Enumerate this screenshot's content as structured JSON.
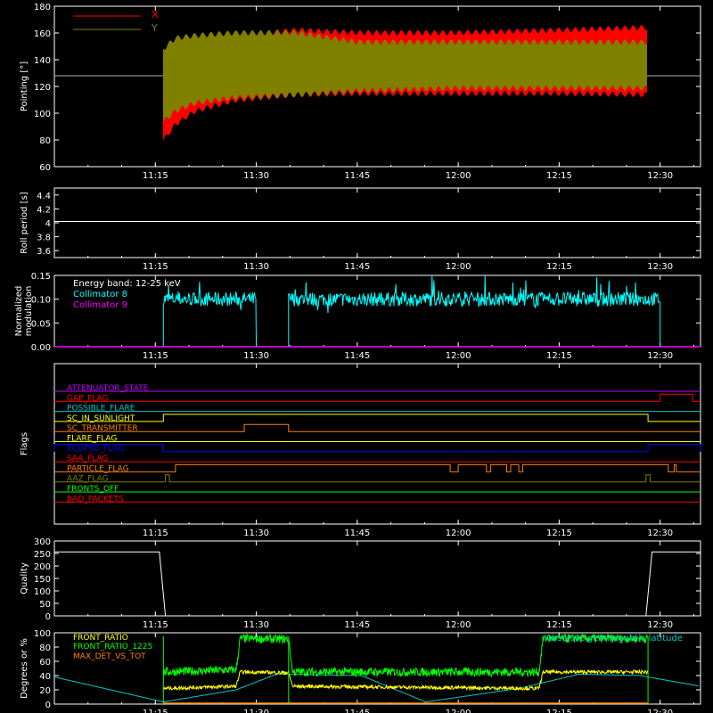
{
  "chart_data": [
    {
      "type": "area",
      "ylabel": "Pointing [°]",
      "ylim": [
        60,
        180
      ],
      "yticks": [
        60,
        80,
        100,
        120,
        140,
        160,
        180
      ],
      "xticks": [
        "11:15",
        "11:30",
        "11:45",
        "12:00",
        "12:15",
        "12:30"
      ],
      "legend": "top-left",
      "series": [
        {
          "name": "X",
          "color": "#ff0000",
          "x": [
            11.27,
            11.3,
            11.35,
            11.45,
            11.6,
            11.75,
            12.0,
            12.25,
            12.47
          ],
          "upper": [
            150,
            148,
            152,
            160,
            164,
            162,
            162,
            164,
            166
          ],
          "lower": [
            78,
            90,
            100,
            108,
            112,
            113,
            113,
            113,
            112
          ]
        },
        {
          "name": "Y",
          "color": "#808000",
          "x": [
            11.27,
            11.3,
            11.35,
            11.45,
            11.6,
            11.75,
            12.0,
            12.25,
            12.47
          ],
          "upper": [
            150,
            158,
            160,
            162,
            162,
            155,
            155,
            155,
            155
          ],
          "lower": [
            92,
            100,
            106,
            110,
            112,
            115,
            117,
            117,
            117
          ]
        }
      ],
      "reference_line": {
        "value": 128,
        "color": "#b0b0b0"
      }
    },
    {
      "type": "line",
      "ylabel": "Roll period [s]",
      "ylim": [
        3.5,
        4.5
      ],
      "yticks": [
        3.6,
        3.8,
        4.0,
        4.2,
        4.4
      ],
      "xticks": [
        "11:15",
        "11:30",
        "11:45",
        "12:00",
        "12:15",
        "12:30"
      ],
      "series": [
        {
          "name": "",
          "color": "#ffffff",
          "value": 4.02
        }
      ]
    },
    {
      "type": "line",
      "ylabel": "Normalized modulation",
      "ylim": [
        0,
        0.15
      ],
      "yticks": [
        "0.00",
        "0.05",
        "0.10",
        "0.15"
      ],
      "xticks": [
        "11:15",
        "11:30",
        "11:45",
        "12:00",
        "12:15",
        "12:30"
      ],
      "legend_title": "Energy band: 12-25 keV",
      "series": [
        {
          "name": "Collimator 8",
          "color": "#00ffff",
          "mean": 0.1,
          "segments": [
            [
              11.27,
              11.5
            ],
            [
              11.58,
              12.5
            ]
          ]
        },
        {
          "name": "Collimator 9",
          "color": "#ff00ff",
          "value": 0.0
        }
      ]
    },
    {
      "type": "line",
      "ylabel": "Flags",
      "xticks": [
        "11:15",
        "11:30",
        "11:45",
        "12:00",
        "12:15",
        "12:30"
      ],
      "flags": [
        {
          "name": "ATTENUATOR_STATE",
          "color": "#c000ff",
          "steps": []
        },
        {
          "name": "GAP_FLAG",
          "color": "#ff0000",
          "steps": [
            [
              12.5,
              12.58,
              1
            ]
          ]
        },
        {
          "name": "POSSIBLE_FLARE",
          "color": "#00c8c8",
          "steps": []
        },
        {
          "name": "SC_IN_SUNLIGHT",
          "color": "#ffff00",
          "steps": [
            [
              11.27,
              12.47,
              1
            ]
          ]
        },
        {
          "name": "SC_TRANSMITTER",
          "color": "#ff8000",
          "steps": [
            [
              11.47,
              11.58,
              1
            ]
          ]
        },
        {
          "name": "FLARE_FLAG",
          "color": "#ffff00",
          "steps": []
        },
        {
          "name": "ECLIPSE_FLAG",
          "color": "#0000ff",
          "steps": [
            [
              11.0,
              11.27,
              1
            ],
            [
              12.47,
              12.6,
              1
            ]
          ]
        },
        {
          "name": "SAA_FLAG",
          "color": "#ff0000",
          "steps": []
        },
        {
          "name": "PARTICLE_FLAG",
          "color": "#ff8000",
          "steps": [
            [
              11.3,
              11.98,
              1
            ],
            [
              12.0,
              12.07,
              1
            ],
            [
              12.08,
              12.12,
              1
            ],
            [
              12.13,
              12.15,
              1
            ],
            [
              12.16,
              12.52,
              1
            ],
            [
              12.535,
              12.54,
              1
            ]
          ]
        },
        {
          "name": "AAZ_FLAG",
          "color": "#808000",
          "steps": [
            [
              11.275,
              11.285,
              1
            ],
            [
              12.465,
              12.475,
              1
            ]
          ]
        },
        {
          "name": "FRONTS_OFF",
          "color": "#00ff00",
          "steps": []
        },
        {
          "name": "BAD_PACKETS",
          "color": "#ff0000",
          "steps": []
        }
      ]
    },
    {
      "type": "line",
      "ylabel": "Quality",
      "ylim": [
        0,
        300
      ],
      "yticks": [
        0,
        50,
        100,
        150,
        200,
        250,
        300
      ],
      "xticks": [
        "11:15",
        "11:30",
        "11:45",
        "12:00",
        "12:15",
        "12:30"
      ],
      "series": [
        {
          "name": "",
          "color": "#ffffff",
          "x": [
            11.0,
            11.26,
            11.275,
            12.465,
            12.48,
            12.6
          ],
          "y": [
            256,
            256,
            0,
            0,
            256,
            256
          ]
        }
      ]
    },
    {
      "type": "line",
      "ylabel": "Degrees or %",
      "ylim": [
        0,
        100
      ],
      "yticks": [
        0,
        20,
        40,
        60,
        80,
        100
      ],
      "xticks": [
        "11:15",
        "11:30",
        "11:45",
        "12:00",
        "12:15",
        "12:30"
      ],
      "annotation": "Absolute geomagnetic latitude",
      "series": [
        {
          "name": "FRONT_RATIO",
          "color": "#ffff00",
          "x": [
            11.27,
            11.45,
            11.46,
            11.58,
            11.59,
            12.2,
            12.21,
            12.47
          ],
          "y": [
            22,
            25,
            45,
            44,
            25,
            22,
            45,
            45
          ]
        },
        {
          "name": "FRONT_RATIO_1225",
          "color": "#00ff00",
          "x": [
            11.27,
            11.45,
            11.46,
            11.58,
            11.59,
            12.2,
            12.21,
            12.47
          ],
          "y": [
            45,
            48,
            92,
            91,
            45,
            45,
            92,
            92
          ]
        },
        {
          "name": "MAX_DET_VS_TOT",
          "color": "#ff8000",
          "x": [
            11.27,
            12.47
          ],
          "y": [
            0,
            0
          ]
        },
        {
          "name": "",
          "color": "#00c8c8",
          "x": [
            11.0,
            11.27,
            11.45,
            11.55,
            11.76,
            11.92,
            12.15,
            12.3,
            12.45,
            12.6
          ],
          "y": [
            38,
            3,
            20,
            42,
            40,
            3,
            22,
            42,
            40,
            25
          ]
        }
      ]
    }
  ]
}
